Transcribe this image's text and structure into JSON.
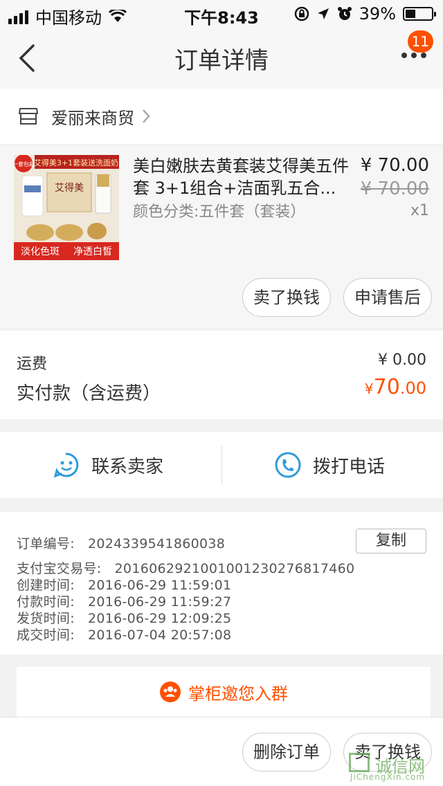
{
  "status_bar": {
    "carrier": "中国移动",
    "time": "下午8:43",
    "battery": "39%",
    "battery_level": 0.39
  },
  "nav": {
    "title": "订单详情",
    "badge_count": "11"
  },
  "shop": {
    "name": "爱丽来商贸"
  },
  "product": {
    "title": "美白嫩肤去黄套装艾得美五件套 3+1组合+洁面乳五合...",
    "sku": "颜色分类:五件套（套装）",
    "price_now": "¥ 70.00",
    "price_old": "¥ 70.00",
    "qty": "x1",
    "image": {
      "corner_tag": "一套包邮",
      "banner": "艾得美3+1套装送洗面奶",
      "brand": "艾得美",
      "bottom_text_1": "淡化色斑",
      "bottom_text_2": "净透白皙"
    },
    "btn_sell": "卖了换钱",
    "btn_after_sale": "申请售后"
  },
  "fees": {
    "shipping_label": "运费",
    "shipping_value": "¥ 0.00",
    "paid_label": "实付款（含运费）",
    "paid_currency": "¥",
    "paid_int": "70",
    "paid_dec": ".00"
  },
  "contact": {
    "seller_label": "联系卖家",
    "phone_label": "拨打电话"
  },
  "order_info": {
    "order_no_label": "订单编号:",
    "order_no": "2024339541860038",
    "copy_label": "复制",
    "alipay_label": "支付宝交易号:",
    "alipay_no": "2016062921001001230276817460",
    "created_label": "创建时间:",
    "created": "2016-06-29 11:59:01",
    "paid_label": "付款时间:",
    "paid": "2016-06-29 11:59:27",
    "shipped_label": "发货时间:",
    "shipped": "2016-06-29 12:09:25",
    "done_label": "成交时间:",
    "done": "2016-07-04 20:57:08"
  },
  "group": {
    "label": "掌柜邀您入群"
  },
  "bottom": {
    "delete_label": "删除订单",
    "sell_label": "卖了换钱"
  },
  "watermark": {
    "main": "诚信网",
    "sub": "JiChengXin.com"
  },
  "colors": {
    "accent": "#ff5000",
    "contact_blue": "#2e9bd8",
    "background": "#f2f2f2"
  },
  "icons": {
    "back": "chevron-left-icon",
    "more": "more-icon",
    "shop": "shop-icon",
    "shop_chevron": "chevron-right-icon",
    "contact": "chat-smile-icon",
    "phone": "phone-icon",
    "group": "group-icon"
  }
}
